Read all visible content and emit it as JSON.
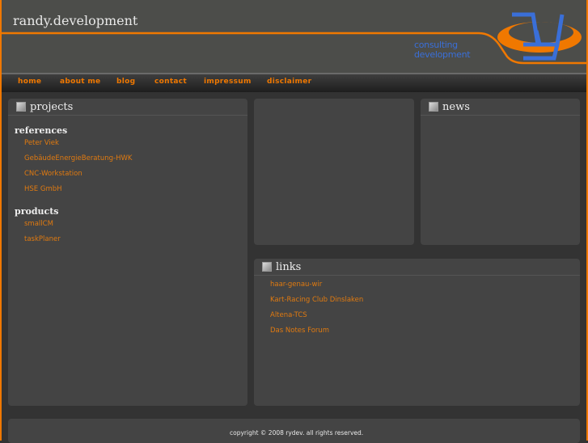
{
  "header": {
    "title": "randy.development",
    "logo_text": [
      "consulting",
      "development"
    ]
  },
  "nav": [
    {
      "label": "home"
    },
    {
      "label": "about me"
    },
    {
      "label": "blog"
    },
    {
      "label": "contact"
    },
    {
      "label": "impressum"
    },
    {
      "label": "disclaimer"
    }
  ],
  "projects": {
    "title": "projects",
    "references_label": "references",
    "references": [
      "Peter Viek",
      "GebäudeEnergieBeratung-HWK",
      "CNC-Workstation",
      "HSE GmbH"
    ],
    "products_label": "products",
    "products": [
      "smallCM",
      "taskPlaner"
    ]
  },
  "news": {
    "title": "news"
  },
  "links": {
    "title": "links",
    "items": [
      "haar-genau-wir",
      "Kart-Racing Club Dinslaken",
      "Altena-TCS",
      "Das Notes Forum"
    ]
  },
  "footer": {
    "copyright": "copyright ©  2008 rydev. all rights reserved."
  },
  "colors": {
    "accent": "#f07800",
    "logo_blue": "#3a6fd8",
    "background": "#333333",
    "panel": "#444444"
  }
}
